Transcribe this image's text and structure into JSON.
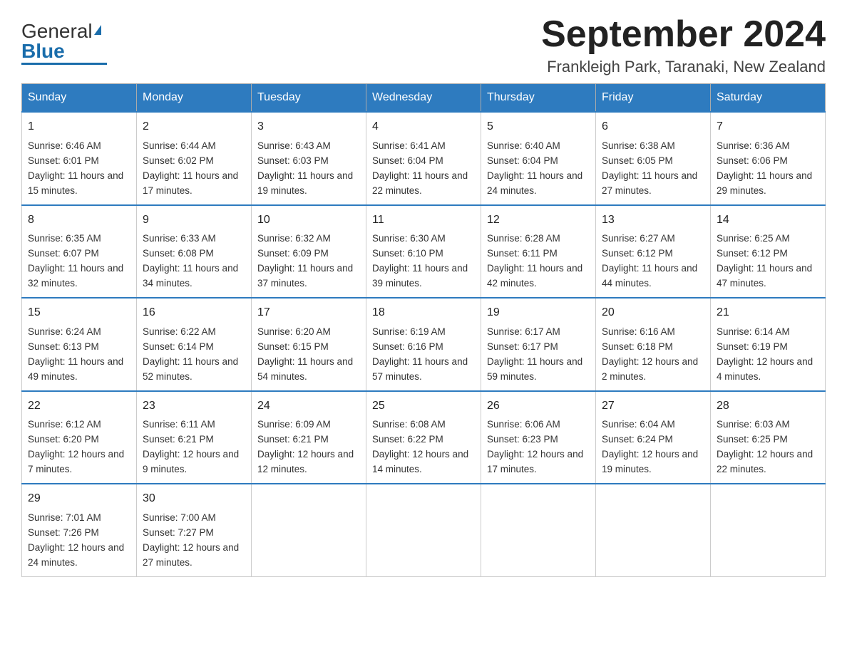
{
  "header": {
    "logo_general": "General",
    "logo_blue": "Blue",
    "month_title": "September 2024",
    "location": "Frankleigh Park, Taranaki, New Zealand"
  },
  "weekdays": [
    "Sunday",
    "Monday",
    "Tuesday",
    "Wednesday",
    "Thursday",
    "Friday",
    "Saturday"
  ],
  "weeks": [
    [
      {
        "day": "1",
        "sunrise": "6:46 AM",
        "sunset": "6:01 PM",
        "daylight": "11 hours and 15 minutes."
      },
      {
        "day": "2",
        "sunrise": "6:44 AM",
        "sunset": "6:02 PM",
        "daylight": "11 hours and 17 minutes."
      },
      {
        "day": "3",
        "sunrise": "6:43 AM",
        "sunset": "6:03 PM",
        "daylight": "11 hours and 19 minutes."
      },
      {
        "day": "4",
        "sunrise": "6:41 AM",
        "sunset": "6:04 PM",
        "daylight": "11 hours and 22 minutes."
      },
      {
        "day": "5",
        "sunrise": "6:40 AM",
        "sunset": "6:04 PM",
        "daylight": "11 hours and 24 minutes."
      },
      {
        "day": "6",
        "sunrise": "6:38 AM",
        "sunset": "6:05 PM",
        "daylight": "11 hours and 27 minutes."
      },
      {
        "day": "7",
        "sunrise": "6:36 AM",
        "sunset": "6:06 PM",
        "daylight": "11 hours and 29 minutes."
      }
    ],
    [
      {
        "day": "8",
        "sunrise": "6:35 AM",
        "sunset": "6:07 PM",
        "daylight": "11 hours and 32 minutes."
      },
      {
        "day": "9",
        "sunrise": "6:33 AM",
        "sunset": "6:08 PM",
        "daylight": "11 hours and 34 minutes."
      },
      {
        "day": "10",
        "sunrise": "6:32 AM",
        "sunset": "6:09 PM",
        "daylight": "11 hours and 37 minutes."
      },
      {
        "day": "11",
        "sunrise": "6:30 AM",
        "sunset": "6:10 PM",
        "daylight": "11 hours and 39 minutes."
      },
      {
        "day": "12",
        "sunrise": "6:28 AM",
        "sunset": "6:11 PM",
        "daylight": "11 hours and 42 minutes."
      },
      {
        "day": "13",
        "sunrise": "6:27 AM",
        "sunset": "6:12 PM",
        "daylight": "11 hours and 44 minutes."
      },
      {
        "day": "14",
        "sunrise": "6:25 AM",
        "sunset": "6:12 PM",
        "daylight": "11 hours and 47 minutes."
      }
    ],
    [
      {
        "day": "15",
        "sunrise": "6:24 AM",
        "sunset": "6:13 PM",
        "daylight": "11 hours and 49 minutes."
      },
      {
        "day": "16",
        "sunrise": "6:22 AM",
        "sunset": "6:14 PM",
        "daylight": "11 hours and 52 minutes."
      },
      {
        "day": "17",
        "sunrise": "6:20 AM",
        "sunset": "6:15 PM",
        "daylight": "11 hours and 54 minutes."
      },
      {
        "day": "18",
        "sunrise": "6:19 AM",
        "sunset": "6:16 PM",
        "daylight": "11 hours and 57 minutes."
      },
      {
        "day": "19",
        "sunrise": "6:17 AM",
        "sunset": "6:17 PM",
        "daylight": "11 hours and 59 minutes."
      },
      {
        "day": "20",
        "sunrise": "6:16 AM",
        "sunset": "6:18 PM",
        "daylight": "12 hours and 2 minutes."
      },
      {
        "day": "21",
        "sunrise": "6:14 AM",
        "sunset": "6:19 PM",
        "daylight": "12 hours and 4 minutes."
      }
    ],
    [
      {
        "day": "22",
        "sunrise": "6:12 AM",
        "sunset": "6:20 PM",
        "daylight": "12 hours and 7 minutes."
      },
      {
        "day": "23",
        "sunrise": "6:11 AM",
        "sunset": "6:21 PM",
        "daylight": "12 hours and 9 minutes."
      },
      {
        "day": "24",
        "sunrise": "6:09 AM",
        "sunset": "6:21 PM",
        "daylight": "12 hours and 12 minutes."
      },
      {
        "day": "25",
        "sunrise": "6:08 AM",
        "sunset": "6:22 PM",
        "daylight": "12 hours and 14 minutes."
      },
      {
        "day": "26",
        "sunrise": "6:06 AM",
        "sunset": "6:23 PM",
        "daylight": "12 hours and 17 minutes."
      },
      {
        "day": "27",
        "sunrise": "6:04 AM",
        "sunset": "6:24 PM",
        "daylight": "12 hours and 19 minutes."
      },
      {
        "day": "28",
        "sunrise": "6:03 AM",
        "sunset": "6:25 PM",
        "daylight": "12 hours and 22 minutes."
      }
    ],
    [
      {
        "day": "29",
        "sunrise": "7:01 AM",
        "sunset": "7:26 PM",
        "daylight": "12 hours and 24 minutes."
      },
      {
        "day": "30",
        "sunrise": "7:00 AM",
        "sunset": "7:27 PM",
        "daylight": "12 hours and 27 minutes."
      },
      null,
      null,
      null,
      null,
      null
    ]
  ]
}
